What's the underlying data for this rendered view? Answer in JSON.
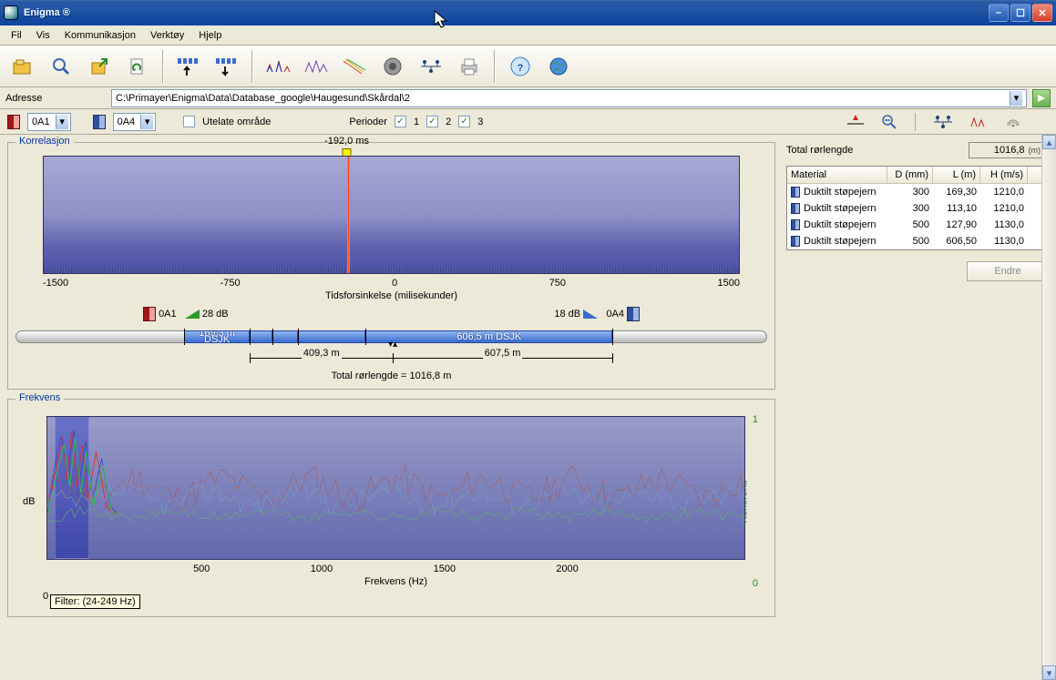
{
  "window": {
    "title": "Enigma ®"
  },
  "menu": {
    "items": [
      "Fil",
      "Vis",
      "Kommunikasjon",
      "Verktøy",
      "Hjelp"
    ]
  },
  "address": {
    "label": "Adresse",
    "path": "C:\\Primayer\\Enigma\\Data\\Database_google\\Haugesund\\Skårdal\\2"
  },
  "selectors": {
    "left_code": "0A1",
    "right_code": "0A4",
    "exclude_label": "Utelate område",
    "periods_label": "Perioder",
    "periods": [
      "1",
      "2",
      "3"
    ]
  },
  "correlation": {
    "group_title": "Korrelasjon",
    "marker_label": "-192,0 ms",
    "marker_pos_pct": 43.6,
    "x_ticks": [
      "-1500",
      "-750",
      "0",
      "750",
      "1500"
    ],
    "x_label": "Tidsforsinkelse (milisekunder)",
    "legend_left_code": "0A1",
    "legend_left_db": "28 dB",
    "legend_right_db": "18 dB",
    "legend_right_code": "0A4"
  },
  "pipe": {
    "segments": [
      {
        "start_pct": 22.4,
        "width_pct": 8.8,
        "label_top": "169,3 m",
        "label_bot": "DSJK"
      },
      {
        "start_pct": 31.2,
        "width_pct": 3.0,
        "label_top": "",
        "label_bot": ""
      },
      {
        "start_pct": 34.2,
        "width_pct": 3.4,
        "label_top": "",
        "label_bot": ""
      },
      {
        "start_pct": 37.6,
        "width_pct": 9.0,
        "label_top": "",
        "label_bot": ""
      },
      {
        "start_pct": 46.6,
        "width_pct": 32.8,
        "label_top": "606,5 m DSJK",
        "label_bot": ""
      }
    ],
    "marker_pct": 50.2,
    "dim_left": {
      "start_pct": 31.2,
      "end_pct": 50.2,
      "label": "409,3 m"
    },
    "dim_right": {
      "start_pct": 50.2,
      "end_pct": 79.4,
      "label": "607,5 m"
    },
    "total_label": "Total rørlengde = 1016,8 m"
  },
  "frequency": {
    "group_title": "Frekvens",
    "y_left": "dB",
    "y_right": "Koherens",
    "ry_top": "1",
    "ry_bot": "0",
    "x_ticks": [
      "0",
      "500",
      "1000",
      "1500",
      "2000"
    ],
    "x_label": "Frekvens (Hz)",
    "filter_info": "Filter: (24-249 Hz)"
  },
  "right_panel": {
    "total_label": "Total rørlengde",
    "total_value": "1016,8",
    "total_unit": "(m)",
    "headers": {
      "mat": "Material",
      "d": "D (mm)",
      "l": "L (m)",
      "h": "H (m/s)"
    },
    "rows": [
      {
        "mat": "Duktilt støpejern",
        "d": "300",
        "l": "169,30",
        "h": "1210,0"
      },
      {
        "mat": "Duktilt støpejern",
        "d": "300",
        "l": "113,10",
        "h": "1210,0"
      },
      {
        "mat": "Duktilt støpejern",
        "d": "500",
        "l": "127,90",
        "h": "1130,0"
      },
      {
        "mat": "Duktilt støpejern",
        "d": "500",
        "l": "606,50",
        "h": "1130,0"
      }
    ],
    "button": "Endre"
  },
  "chart_data": [
    {
      "type": "line",
      "title": "Korrelasjon",
      "xlabel": "Tidsforsinkelse (milisekunder)",
      "xlim": [
        -1500,
        1500
      ],
      "peak_x_ms": -192.0,
      "note": "Single sharp correlation peak at -192 ms; baseline noise elsewhere near zero."
    },
    {
      "type": "line",
      "title": "Frekvens",
      "xlabel": "Frekvens (Hz)",
      "ylabel_left": "dB",
      "ylabel_right": "Koherens",
      "xlim": [
        0,
        2300
      ],
      "y_right_lim": [
        0,
        1
      ],
      "filter_band_hz": [
        24,
        249
      ],
      "note": "Three overlaid spectra (red, blue, green) plus coherence; strong energy below ~250 Hz within filter band, broadband low-level noise to ~2300 Hz."
    }
  ]
}
